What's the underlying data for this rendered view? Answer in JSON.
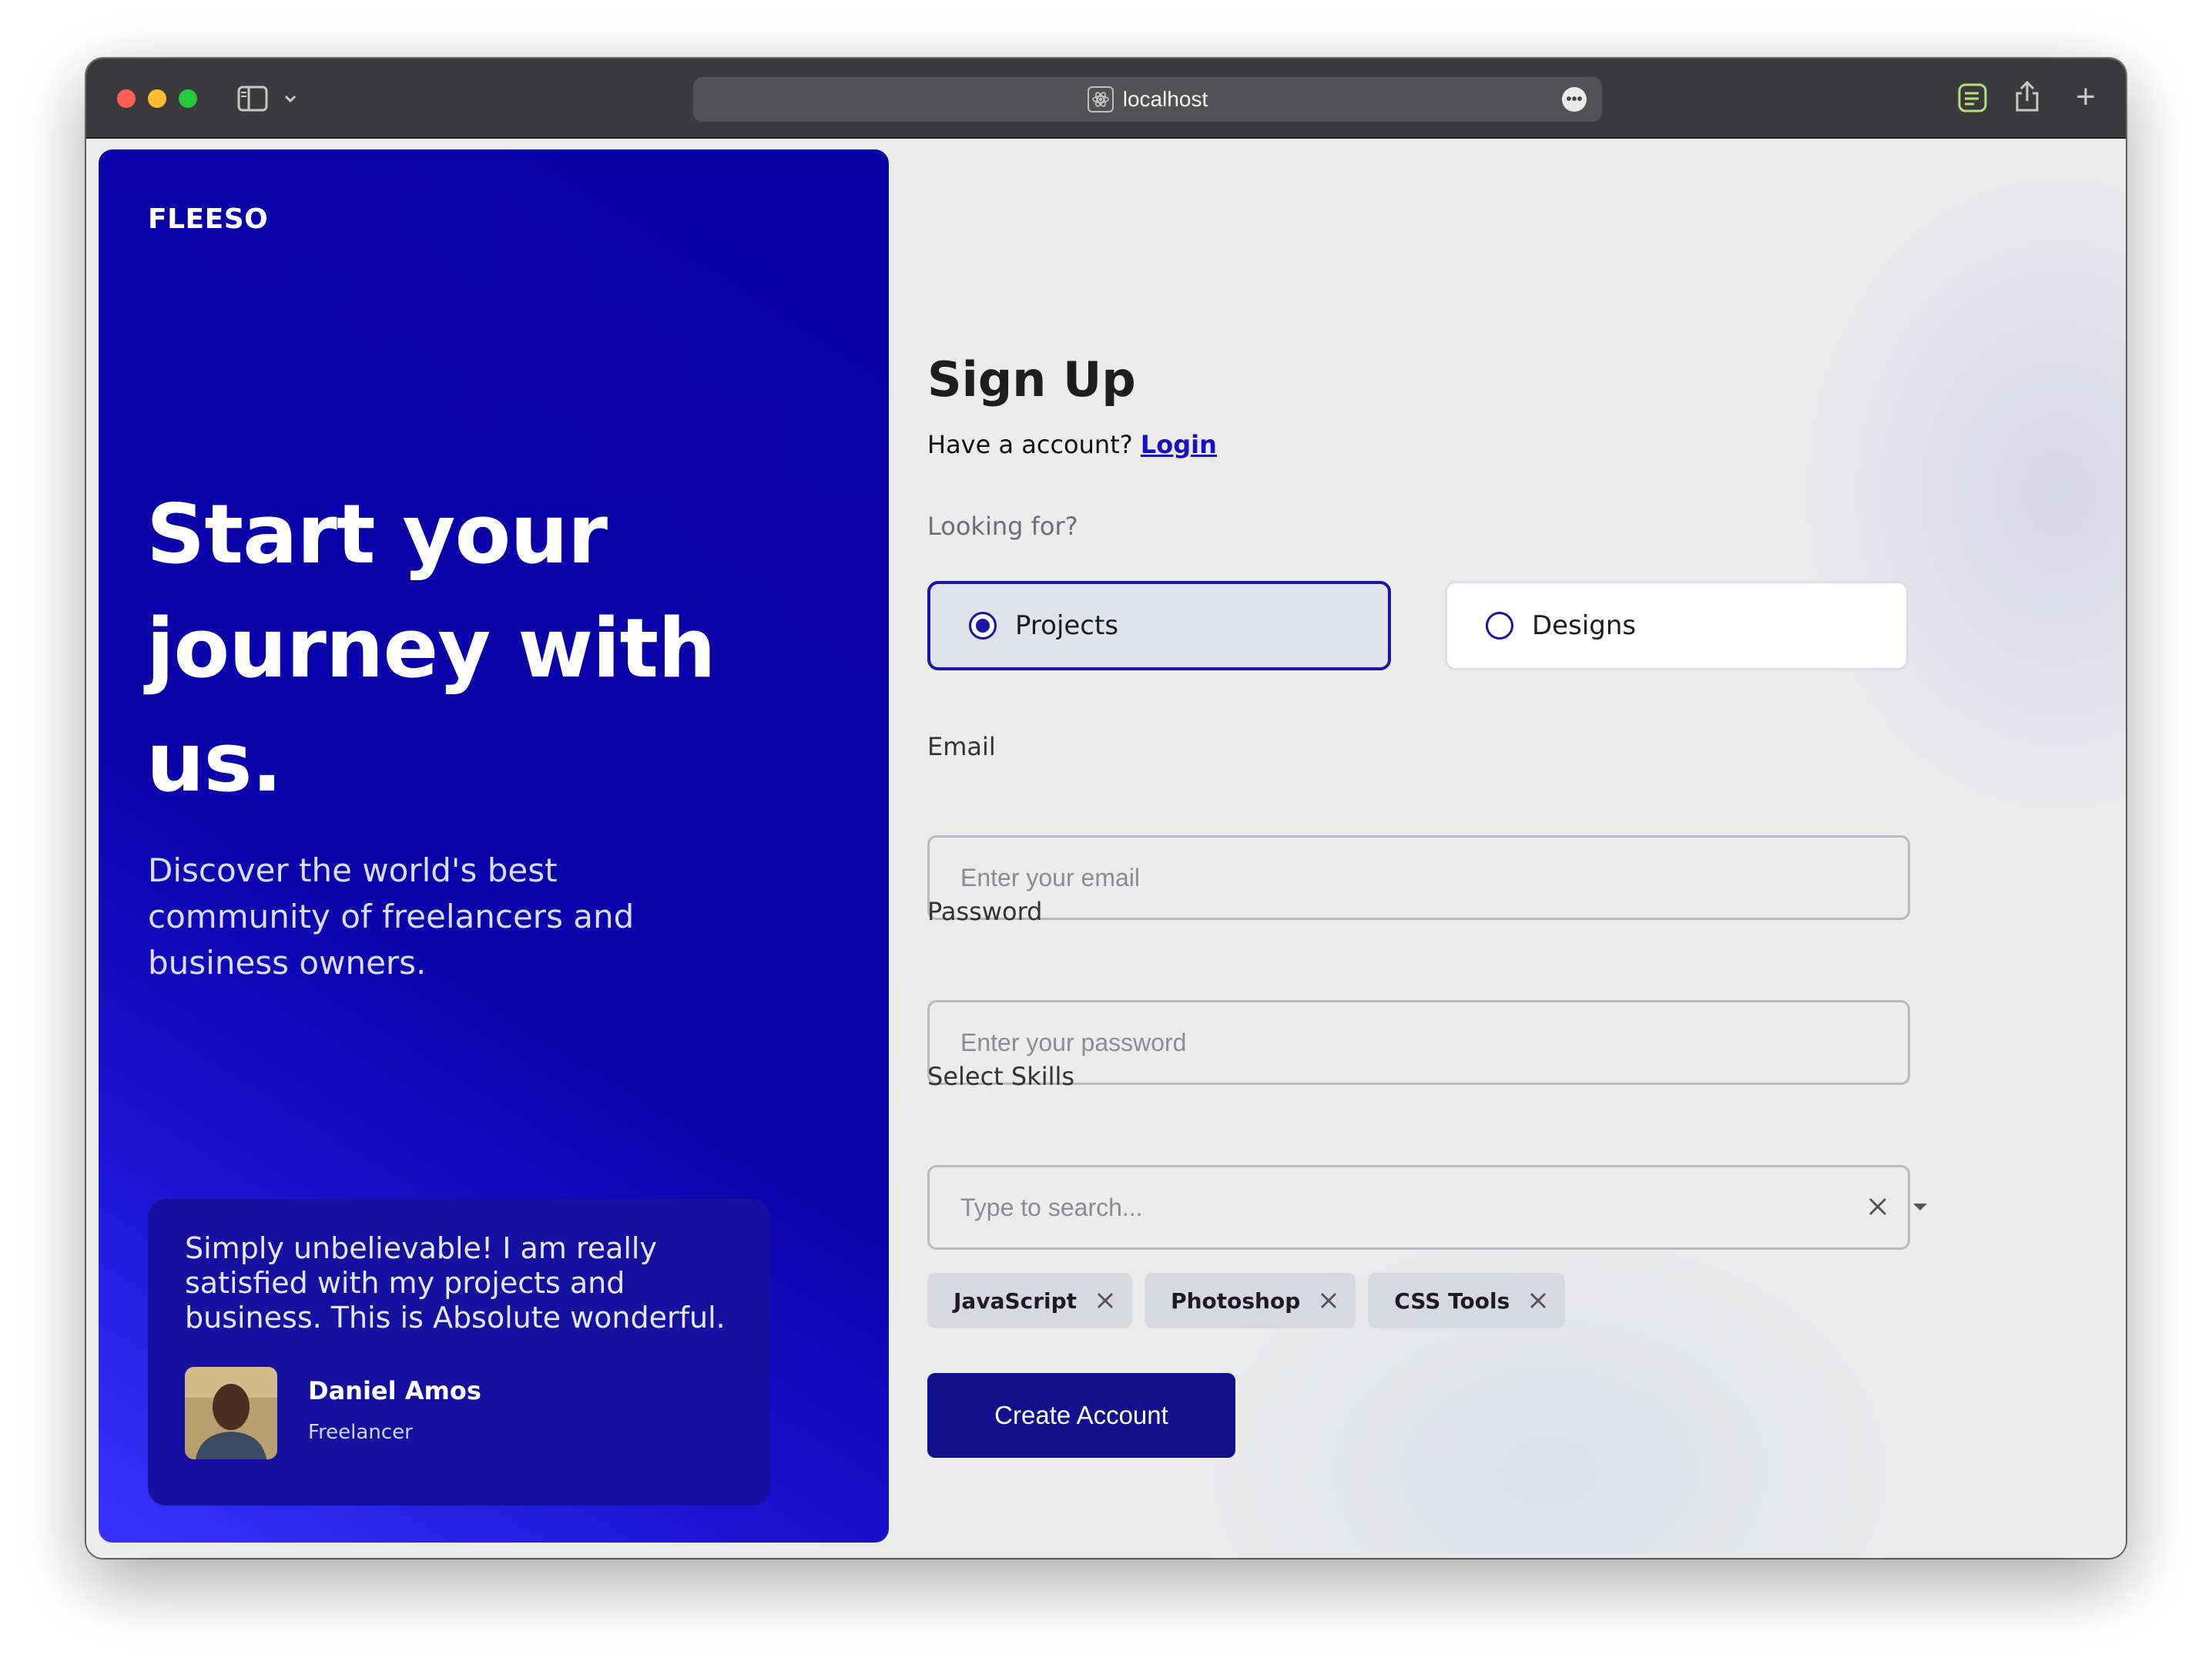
{
  "browser": {
    "url": "localhost"
  },
  "hero": {
    "brand": "FLEESO",
    "headline": "Start your journey with us.",
    "subtext": "Discover the world's best community of freelancers and business owners.",
    "testimonial": {
      "quote": "Simply unbelievable! I am really satisfied with my projects and business. This is Absolute wonderful.",
      "author_name": "Daniel Amos",
      "author_role": "Freelancer"
    }
  },
  "form": {
    "title": "Sign Up",
    "have_account_text": "Have a account?",
    "login_link": "Login",
    "looking_for_label": "Looking for?",
    "options": [
      {
        "label": "Projects",
        "selected": true
      },
      {
        "label": "Designs",
        "selected": false
      }
    ],
    "email": {
      "label": "Email",
      "placeholder": "Enter your email",
      "value": ""
    },
    "password": {
      "label": "Password",
      "placeholder": "Enter your password",
      "value": ""
    },
    "skills": {
      "label": "Select Skills",
      "placeholder": "Type to search...",
      "selected": [
        "JavaScript",
        "Photoshop",
        "CSS Tools"
      ]
    },
    "submit_label": "Create Account"
  },
  "colors": {
    "brand_primary": "#13108e",
    "hero_gradient_dark": "#0800a4",
    "hero_gradient_light": "#3a33ff",
    "page_background": "#ececec"
  },
  "icons": [
    "sidebar-icon",
    "chevron-down-icon",
    "site-icon",
    "more-icon",
    "notes-icon",
    "share-icon",
    "plus-icon",
    "close-icon",
    "caret-down-icon"
  ]
}
